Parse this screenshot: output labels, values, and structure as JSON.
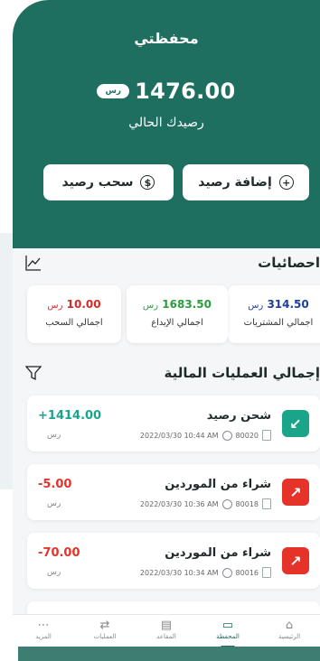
{
  "header": {
    "title": "محفظتي",
    "currency": "رس",
    "balance": "1476.00",
    "balance_label": "رصيدك الحالي",
    "add_label": "إضافة رصيد",
    "withdraw_label": "سحب رصيد",
    "color": "#1e6f60"
  },
  "stats": {
    "title": "احصائيات",
    "cards": [
      {
        "value": "314.50",
        "unit": "رس",
        "label": "اجمالي المشتريات",
        "color": "#1e3f9a"
      },
      {
        "value": "1683.50",
        "unit": "رس",
        "label": "اجمالي الإيداع",
        "color": "#2a9d3f"
      },
      {
        "value": "10.00",
        "unit": "رس",
        "label": "اجمالي السحب",
        "color": "#d62828"
      }
    ]
  },
  "transactions": {
    "title": "إجمالي العمليات المالية",
    "items": [
      {
        "title": "شحن رصيد",
        "code": "80020",
        "datetime": "2022/03/30 10:44 AM",
        "amount": "+1414.00",
        "currency": "رس",
        "type": "deposit",
        "color": "#1aa58a"
      },
      {
        "title": "شراء من الموردين",
        "code": "80018",
        "datetime": "2022/03/30 10:36 AM",
        "amount": "-5.00",
        "currency": "رس",
        "type": "purchase",
        "color": "#e5332a"
      },
      {
        "title": "شراء من الموردين",
        "code": "80016",
        "datetime": "2022/03/30 10:34 AM",
        "amount": "-70.00",
        "currency": "رس",
        "type": "purchase",
        "color": "#e5332a"
      }
    ]
  },
  "tabbar": {
    "items": [
      {
        "label": "الرئيسية",
        "icon": "home-icon"
      },
      {
        "label": "المحفظة",
        "icon": "wallet-icon",
        "active": true
      },
      {
        "label": "المقاعد",
        "icon": "seats-icon"
      },
      {
        "label": "العمليات",
        "icon": "operations-icon"
      },
      {
        "label": "المزيد",
        "icon": "more-icon"
      }
    ]
  }
}
